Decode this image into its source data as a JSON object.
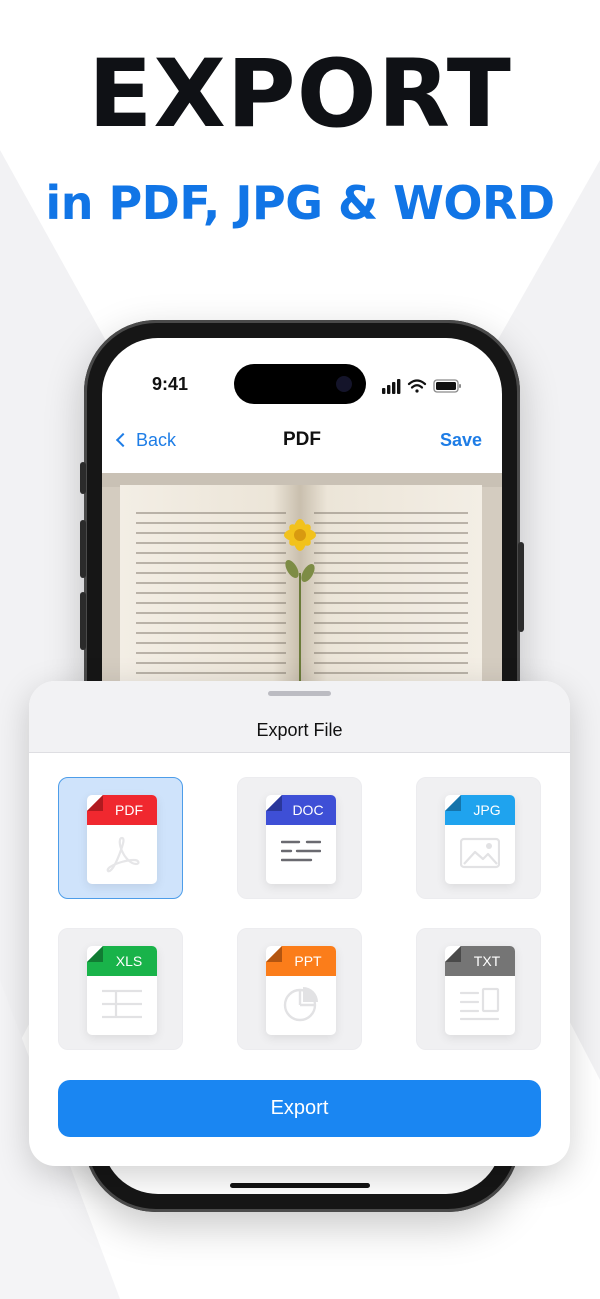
{
  "headline": "EXPORT",
  "subline": "in PDF, JPG & WORD",
  "status": {
    "time": "9:41"
  },
  "nav": {
    "back_label": "Back",
    "title": "PDF",
    "save_label": "Save"
  },
  "sheet": {
    "title": "Export File",
    "formats": [
      {
        "label": "PDF",
        "color": "#f0282f",
        "icon": "acrobat-icon",
        "selected": true
      },
      {
        "label": "DOC",
        "color": "#3e4fd6",
        "icon": "text-lines-icon",
        "selected": false
      },
      {
        "label": "JPG",
        "color": "#1fa3ee",
        "icon": "image-icon",
        "selected": false
      },
      {
        "label": "XLS",
        "color": "#19b34a",
        "icon": "table-icon",
        "selected": false
      },
      {
        "label": "PPT",
        "color": "#fb7d1a",
        "icon": "pie-chart-icon",
        "selected": false
      },
      {
        "label": "TXT",
        "color": "#757575",
        "icon": "text-layout-icon",
        "selected": false
      }
    ],
    "export_label": "Export"
  },
  "colors": {
    "accent": "#1a86f2",
    "headline": "#0f1115",
    "subline": "#1175e6"
  }
}
